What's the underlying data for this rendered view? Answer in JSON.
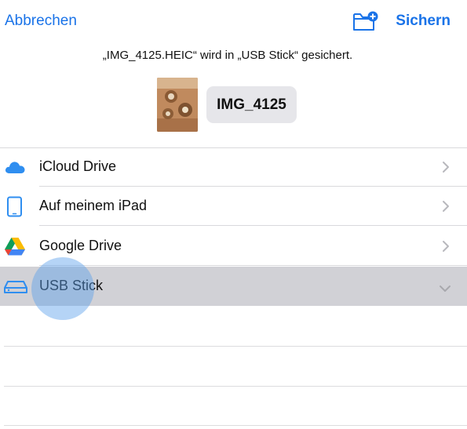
{
  "header": {
    "cancel_label": "Abbrechen",
    "save_label": "Sichern",
    "new_folder_icon": "folder-plus-icon"
  },
  "message": "„IMG_4125.HEIC“ wird in „USB Stick“ gesichert.",
  "file": {
    "name": "IMG_4125"
  },
  "locations": [
    {
      "label": "iCloud Drive",
      "icon": "icloud-icon",
      "expanded": false
    },
    {
      "label": "Auf meinem iPad",
      "icon": "ipad-icon",
      "expanded": false
    },
    {
      "label": "Google Drive",
      "icon": "google-drive-icon",
      "expanded": false
    },
    {
      "label": "USB Stick",
      "icon": "drive-icon",
      "expanded": true,
      "selected": true
    }
  ],
  "colors": {
    "accent": "#1a73e8",
    "selected_row": "#d1d1d6",
    "touch_indicator": "#5aa0eb"
  }
}
